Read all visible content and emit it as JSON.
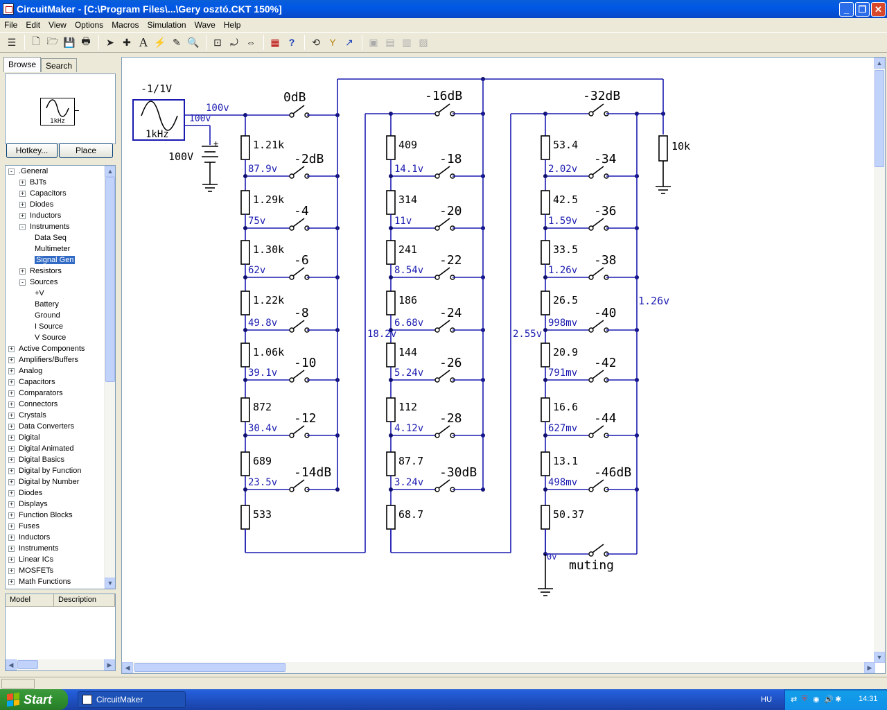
{
  "window": {
    "title": "CircuitMaker - [C:\\Program Files\\...\\Gery osztó.CKT 150%]"
  },
  "menu": [
    "File",
    "Edit",
    "View",
    "Options",
    "Macros",
    "Simulation",
    "Wave",
    "Help"
  ],
  "browser": {
    "tabs": [
      "Browse",
      "Search"
    ],
    "preview_label": "1kHz",
    "hotkey_label": "Hotkey...",
    "place_label": "Place",
    "tree": [
      {
        "label": ".General",
        "level": 0,
        "sign": "-"
      },
      {
        "label": "BJTs",
        "level": 1,
        "sign": "+"
      },
      {
        "label": "Capacitors",
        "level": 1,
        "sign": "+"
      },
      {
        "label": "Diodes",
        "level": 1,
        "sign": "+"
      },
      {
        "label": "Inductors",
        "level": 1,
        "sign": "+"
      },
      {
        "label": "Instruments",
        "level": 1,
        "sign": "-"
      },
      {
        "label": "Data Seq",
        "level": 2,
        "sign": ""
      },
      {
        "label": "Multimeter",
        "level": 2,
        "sign": ""
      },
      {
        "label": "Signal Gen",
        "level": 2,
        "sign": "",
        "selected": true
      },
      {
        "label": "Resistors",
        "level": 1,
        "sign": "+"
      },
      {
        "label": "Sources",
        "level": 1,
        "sign": "-"
      },
      {
        "label": "+V",
        "level": 2,
        "sign": ""
      },
      {
        "label": "Battery",
        "level": 2,
        "sign": ""
      },
      {
        "label": "Ground",
        "level": 2,
        "sign": ""
      },
      {
        "label": "I Source",
        "level": 2,
        "sign": ""
      },
      {
        "label": "V Source",
        "level": 2,
        "sign": ""
      },
      {
        "label": "Active Components",
        "level": 0,
        "sign": "+"
      },
      {
        "label": "Amplifiers/Buffers",
        "level": 0,
        "sign": "+"
      },
      {
        "label": "Analog",
        "level": 0,
        "sign": "+"
      },
      {
        "label": "Capacitors",
        "level": 0,
        "sign": "+"
      },
      {
        "label": "Comparators",
        "level": 0,
        "sign": "+"
      },
      {
        "label": "Connectors",
        "level": 0,
        "sign": "+"
      },
      {
        "label": "Crystals",
        "level": 0,
        "sign": "+"
      },
      {
        "label": "Data Converters",
        "level": 0,
        "sign": "+"
      },
      {
        "label": "Digital",
        "level": 0,
        "sign": "+"
      },
      {
        "label": "Digital Animated",
        "level": 0,
        "sign": "+"
      },
      {
        "label": "Digital Basics",
        "level": 0,
        "sign": "+"
      },
      {
        "label": "Digital by Function",
        "level": 0,
        "sign": "+"
      },
      {
        "label": "Digital by Number",
        "level": 0,
        "sign": "+"
      },
      {
        "label": "Diodes",
        "level": 0,
        "sign": "+"
      },
      {
        "label": "Displays",
        "level": 0,
        "sign": "+"
      },
      {
        "label": "Function Blocks",
        "level": 0,
        "sign": "+"
      },
      {
        "label": "Fuses",
        "level": 0,
        "sign": "+"
      },
      {
        "label": "Inductors",
        "level": 0,
        "sign": "+"
      },
      {
        "label": "Instruments",
        "level": 0,
        "sign": "+"
      },
      {
        "label": "Linear ICs",
        "level": 0,
        "sign": "+"
      },
      {
        "label": "MOSFETs",
        "level": 0,
        "sign": "+"
      },
      {
        "label": "Math Functions",
        "level": 0,
        "sign": "+"
      }
    ],
    "model_columns": [
      "Model",
      "Description"
    ]
  },
  "circuit": {
    "generator": {
      "amplitude": "-1/1V",
      "freq": "1kHz",
      "out_v": "100v",
      "out_v2": "100v"
    },
    "battery_label": "100V",
    "col1": {
      "top_switch": "0dB",
      "resistors": [
        "1.21k",
        "1.29k",
        "1.30k",
        "1.22k",
        "1.06k",
        "872",
        "689",
        "533"
      ],
      "voltages": [
        "87.9v",
        "75v",
        "62v",
        "49.8v",
        "39.1v",
        "30.4v",
        "23.5v"
      ],
      "switches": [
        "-2dB",
        "-4",
        "-6",
        "-8",
        "-10",
        "-12",
        "-14dB"
      ]
    },
    "col2": {
      "top_switch": "-16dB",
      "link_v": "18.2v",
      "resistors": [
        "409",
        "314",
        "241",
        "186",
        "144",
        "112",
        "87.7",
        "68.7"
      ],
      "voltages": [
        "14.1v",
        "11v",
        "8.54v",
        "6.68v",
        "5.24v",
        "4.12v",
        "3.24v"
      ],
      "switches": [
        "-18",
        "-20",
        "-22",
        "-24",
        "-26",
        "-28",
        "-30dB"
      ]
    },
    "col3": {
      "top_switch": "-32dB",
      "link_v": "2.55v",
      "out_v": "1.26v",
      "resistors": [
        "53.4",
        "42.5",
        "33.5",
        "26.5",
        "20.9",
        "16.6",
        "13.1",
        "50.37"
      ],
      "voltages": [
        "2.02v",
        "1.59v",
        "1.26v",
        "998mv",
        "791mv",
        "627mv",
        "498mv"
      ],
      "switches": [
        "-34",
        "-36",
        "-38",
        "-40",
        "-42",
        "-44",
        "-46dB"
      ],
      "muting": "muting",
      "muting_v": "0v"
    },
    "load": "10k"
  },
  "taskbar": {
    "start": "Start",
    "app": "CircuitMaker",
    "lang": "HU",
    "clock": "14:31"
  }
}
